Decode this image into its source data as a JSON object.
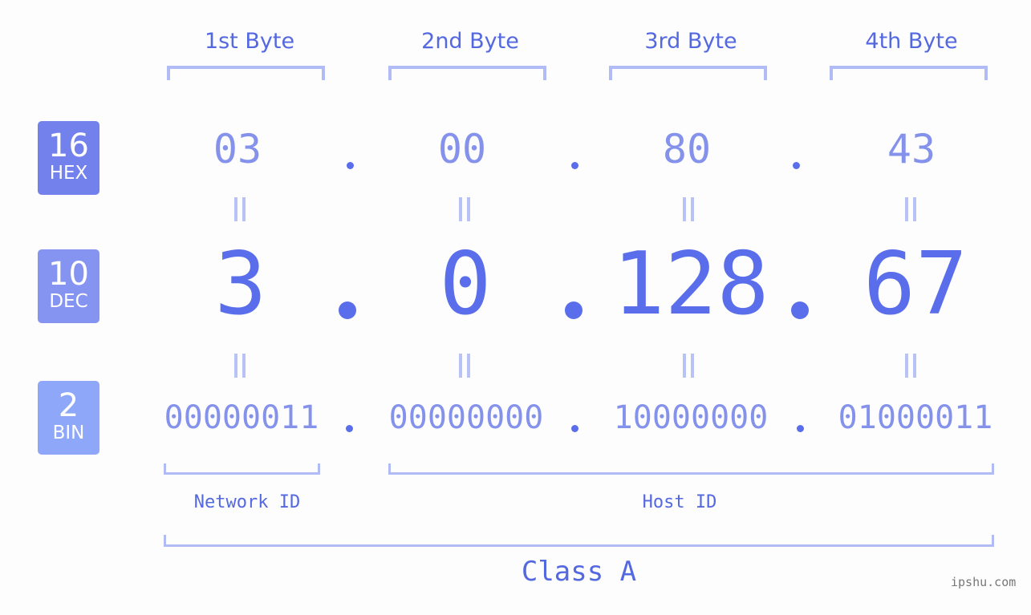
{
  "byte_headers": [
    "1st Byte",
    "2nd Byte",
    "3rd Byte",
    "4th Byte"
  ],
  "badges": {
    "hex": {
      "num": "16",
      "label": "HEX",
      "color": "#7281ec"
    },
    "dec": {
      "num": "10",
      "label": "DEC",
      "color": "#8593f1"
    },
    "bin": {
      "num": "2",
      "label": "BIN",
      "color": "#8ea7f8"
    }
  },
  "hex": [
    "03",
    "00",
    "80",
    "43"
  ],
  "dec": [
    "3",
    "0",
    "128",
    "67"
  ],
  "bin": [
    "00000011",
    "00000000",
    "10000000",
    "01000011"
  ],
  "network_id_label": "Network ID",
  "host_id_label": "Host ID",
  "class_label": "Class A",
  "watermark": "ipshu.com",
  "colors": {
    "accent": "#5a6eeb",
    "bracket": "#b1bbf6",
    "light_value": "#8592ec",
    "background": "#fcfdfc"
  }
}
